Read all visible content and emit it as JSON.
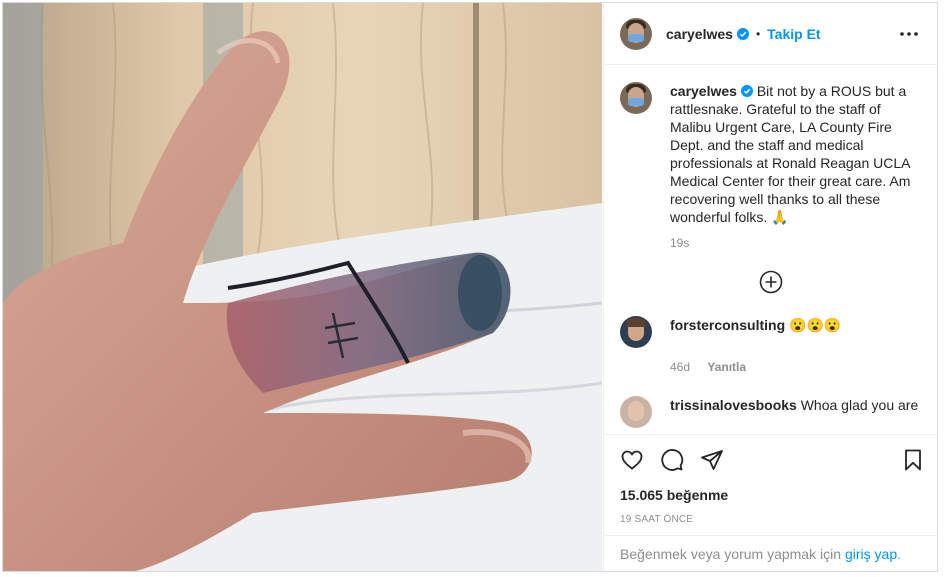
{
  "post": {
    "image_alt": "Swollen bruised finger with tattoo and marker line",
    "author": "caryelwes",
    "follow_label": "Takip Et",
    "separator": "•",
    "caption": "Bit not by a ROUS but a rattlesnake. Grateful to the staff of Malibu Urgent Care, LA County Fire Dept. and the staff and medical professionals at Ronald Reagan UCLA Medical Center for their great care. Am recovering well thanks to all these wonderful folks. 🙏",
    "caption_age": "19s",
    "comments": [
      {
        "user": "forsterconsulting",
        "text": "😮😮😮",
        "age": "46d",
        "reply_label": "Yanıtla"
      },
      {
        "user": "trissinalovesbooks",
        "text": "Whoa glad you are"
      }
    ],
    "likes": "15.065 beğenme",
    "posted": "19 SAAT ÖNCE",
    "login_prompt": "Beğenmek veya yorum yapmak için",
    "login_link": "giriş yap",
    "login_suffix": "."
  },
  "colors": {
    "accent": "#0095f6",
    "muted": "#8e8e8e",
    "text": "#262626"
  },
  "icons": [
    "verified-badge-icon",
    "more-options-icon",
    "load-more-icon",
    "heart-icon",
    "comment-icon",
    "share-icon",
    "bookmark-icon"
  ]
}
